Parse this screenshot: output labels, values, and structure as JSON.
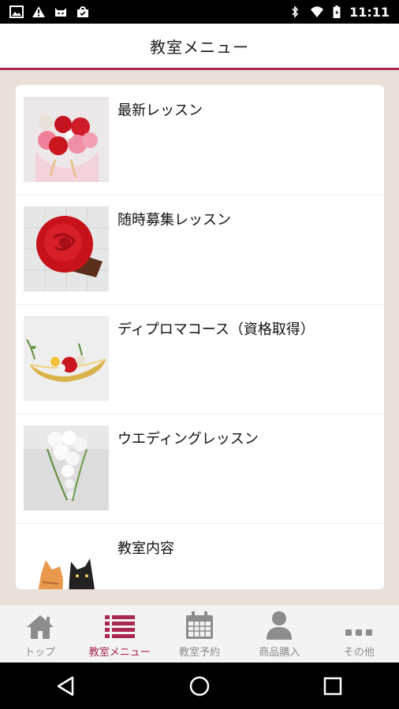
{
  "status_bar": {
    "time": "11:11",
    "left_icons": [
      "image-notification-icon",
      "warning-notification-icon",
      "cat-notification-icon",
      "shopping-bag-notification-icon"
    ],
    "right_icons": [
      "bluetooth-icon",
      "wifi-icon",
      "battery-icon"
    ]
  },
  "header": {
    "title": "教室メニュー"
  },
  "menu": {
    "items": [
      {
        "label": "最新レッスン",
        "thumbnail": "red-pink-flower-bouquet"
      },
      {
        "label": "随時募集レッスン",
        "thumbnail": "red-rose"
      },
      {
        "label": "ディプロマコース（資格取得）",
        "thumbnail": "gold-boat-arrangement"
      },
      {
        "label": "ウエディングレッスン",
        "thumbnail": "white-wedding-bouquet"
      },
      {
        "label": "教室内容",
        "thumbnail": "cats-with-flowers"
      }
    ]
  },
  "tabs": [
    {
      "label": "トップ",
      "icon": "home-icon",
      "active": false
    },
    {
      "label": "教室メニュー",
      "icon": "list-icon",
      "active": true
    },
    {
      "label": "教室予約",
      "icon": "calendar-icon",
      "active": false
    },
    {
      "label": "商品購入",
      "icon": "person-icon",
      "active": false
    },
    {
      "label": "その他",
      "icon": "more-icon",
      "active": false
    }
  ],
  "colors": {
    "accent": "#a8284f",
    "background": "#e9e1d8",
    "inactive": "#8c8c8c"
  }
}
